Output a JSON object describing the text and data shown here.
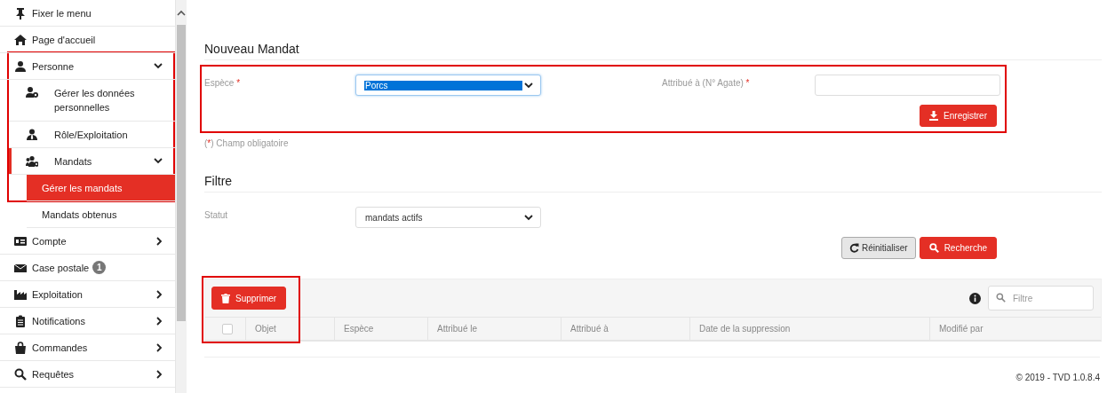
{
  "sidebar": {
    "items": [
      {
        "label": "Fixer le menu",
        "selected": false
      },
      {
        "label": "Page d'accueil",
        "selected": false
      },
      {
        "label": "Personne",
        "selected": false,
        "expanded": true,
        "highlighted": true,
        "children": [
          {
            "label": "Gérer les données personnelles",
            "selected": false
          },
          {
            "label": "Rôle/Exploitation",
            "selected": false
          },
          {
            "label": "Mandats",
            "selected": false,
            "expanded": true,
            "children": [
              {
                "label": "Gérer les mandats",
                "selected": true
              },
              {
                "label": "Mandats obtenus",
                "selected": false
              }
            ]
          }
        ]
      },
      {
        "label": "Compte",
        "selected": false,
        "expanded": false
      },
      {
        "label": "Case postale",
        "selected": false,
        "badge": "1"
      },
      {
        "label": "Exploitation",
        "selected": false,
        "expanded": false
      },
      {
        "label": "Notifications",
        "selected": false,
        "expanded": false
      },
      {
        "label": "Commandes",
        "selected": false,
        "expanded": false
      },
      {
        "label": "Requêtes",
        "selected": false,
        "expanded": false
      }
    ]
  },
  "new_mandate": {
    "title": "Nouveau Mandat",
    "highlighted": true,
    "fields": [
      {
        "kind": "select",
        "label": "Espèce",
        "mark": "*",
        "value": "Porcs",
        "focused": true
      },
      {
        "kind": "text",
        "label": "Attribué à (N° Agate)",
        "mark": "*"
      }
    ],
    "save_button": "Enregistrer",
    "legend": {
      "open": "(",
      "mark": "*",
      "rest": ") Champ obligatoire"
    }
  },
  "filter": {
    "title": "Filtre",
    "fields": [
      {
        "kind": "select",
        "label": "Statut",
        "value": "mandats actifs",
        "focused": false
      }
    ],
    "reset_button": "Réinitialiser",
    "search_button": "Recherche"
  },
  "table": {
    "highlighted": true,
    "delete_button": "Supprimer",
    "search": {
      "placeholder": "Filtre"
    },
    "select_all": {
      "checked": false
    },
    "columns": [
      "Objet",
      "Espèce",
      "Attribué le",
      "Attribué à",
      "Date de la suppression",
      "Modifié par"
    ]
  },
  "footer": "© 2019 - TVD 1.0.8.4"
}
